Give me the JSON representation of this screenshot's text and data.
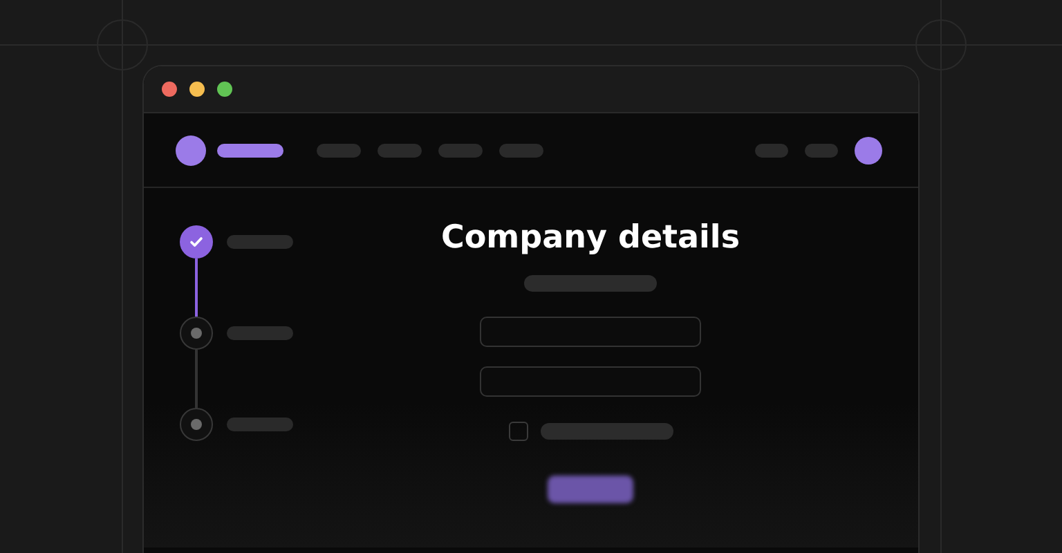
{
  "steps": [
    {
      "done": true
    },
    {
      "done": false
    },
    {
      "done": false
    }
  ],
  "form": {
    "heading": "Company details",
    "checkbox": {
      "checked": false
    }
  }
}
